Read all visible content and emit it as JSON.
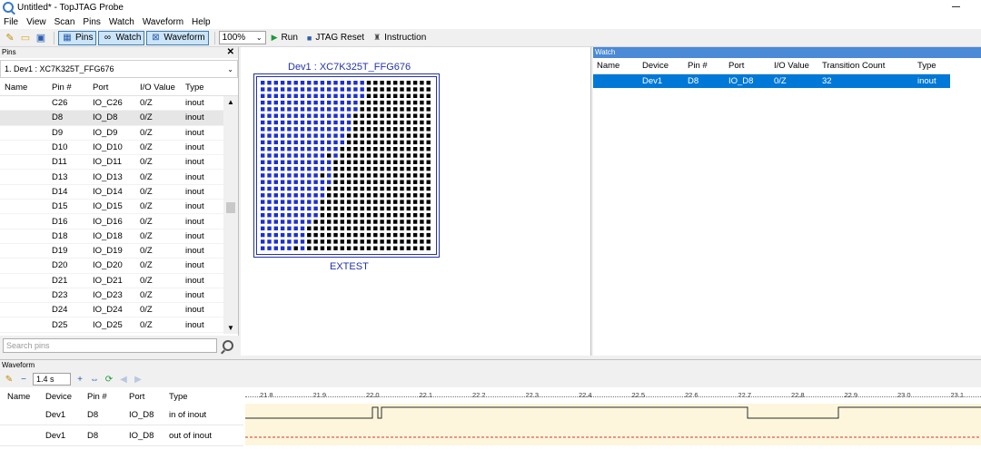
{
  "window": {
    "title": "Untitled* - TopJTAG Probe"
  },
  "menu": [
    "File",
    "View",
    "Scan",
    "Pins",
    "Watch",
    "Waveform",
    "Help"
  ],
  "toolbar": {
    "pins_label": "Pins",
    "watch_label": "Watch",
    "waveform_label": "Waveform",
    "zoom": "100%",
    "run_label": "Run",
    "jtag_reset_label": "JTAG Reset",
    "instruction_label": "Instruction"
  },
  "pins_panel": {
    "header": "Pins",
    "device": "1.  Dev1 : XC7K325T_FFG676",
    "columns": [
      "Name",
      "Pin #",
      "Port",
      "I/O Value",
      "Type"
    ],
    "rows": [
      {
        "name": "",
        "pin": "C26",
        "port": "IO_C26",
        "io": "0/Z",
        "type": "inout"
      },
      {
        "name": "",
        "pin": "D8",
        "port": "IO_D8",
        "io": "0/Z",
        "type": "inout"
      },
      {
        "name": "",
        "pin": "D9",
        "port": "IO_D9",
        "io": "0/Z",
        "type": "inout"
      },
      {
        "name": "",
        "pin": "D10",
        "port": "IO_D10",
        "io": "0/Z",
        "type": "inout"
      },
      {
        "name": "",
        "pin": "D11",
        "port": "IO_D11",
        "io": "0/Z",
        "type": "inout"
      },
      {
        "name": "",
        "pin": "D13",
        "port": "IO_D13",
        "io": "0/Z",
        "type": "inout"
      },
      {
        "name": "",
        "pin": "D14",
        "port": "IO_D14",
        "io": "0/Z",
        "type": "inout"
      },
      {
        "name": "",
        "pin": "D15",
        "port": "IO_D15",
        "io": "0/Z",
        "type": "inout"
      },
      {
        "name": "",
        "pin": "D16",
        "port": "IO_D16",
        "io": "0/Z",
        "type": "inout"
      },
      {
        "name": "",
        "pin": "D18",
        "port": "IO_D18",
        "io": "0/Z",
        "type": "inout"
      },
      {
        "name": "",
        "pin": "D19",
        "port": "IO_D19",
        "io": "0/Z",
        "type": "inout"
      },
      {
        "name": "",
        "pin": "D20",
        "port": "IO_D20",
        "io": "0/Z",
        "type": "inout"
      },
      {
        "name": "",
        "pin": "D21",
        "port": "IO_D21",
        "io": "0/Z",
        "type": "inout"
      },
      {
        "name": "",
        "pin": "D23",
        "port": "IO_D23",
        "io": "0/Z",
        "type": "inout"
      },
      {
        "name": "",
        "pin": "D24",
        "port": "IO_D24",
        "io": "0/Z",
        "type": "inout"
      },
      {
        "name": "",
        "pin": "D25",
        "port": "IO_D25",
        "io": "0/Z",
        "type": "inout"
      }
    ],
    "search_placeholder": "Search pins"
  },
  "package": {
    "title": "Dev1 : XC7K325T_FFG676",
    "mode": "EXTEST",
    "colors": {
      "black": "#000000",
      "blue": "#1c2fd0",
      "red": "#e0202a",
      "outline": "#2533a8"
    }
  },
  "watch_panel": {
    "header": "Watch",
    "columns": [
      "Name",
      "Device",
      "Pin #",
      "Port",
      "I/O Value",
      "Transition Count",
      "Type"
    ],
    "rows": [
      {
        "name": "",
        "device": "Dev1",
        "pin": "D8",
        "port": "IO_D8",
        "io": "0/Z",
        "transitions": "32",
        "type": "inout"
      }
    ]
  },
  "waveform_panel": {
    "header": "Waveform",
    "time": "1.4 s",
    "columns": [
      "Name",
      "Device",
      "Pin #",
      "Port",
      "Type"
    ],
    "ruler": [
      "21.8",
      "21.9",
      "22.0",
      "22.1",
      "22.2",
      "22.3",
      "22.4",
      "22.5",
      "22.6",
      "22.7",
      "22.8",
      "22.9",
      "23.0",
      "23.1"
    ],
    "rows": [
      {
        "name": "",
        "device": "Dev1",
        "pin": "D8",
        "port": "IO_D8",
        "type": "in of inout"
      },
      {
        "name": "",
        "device": "Dev1",
        "pin": "D8",
        "port": "IO_D8",
        "type": "out of inout"
      }
    ]
  }
}
